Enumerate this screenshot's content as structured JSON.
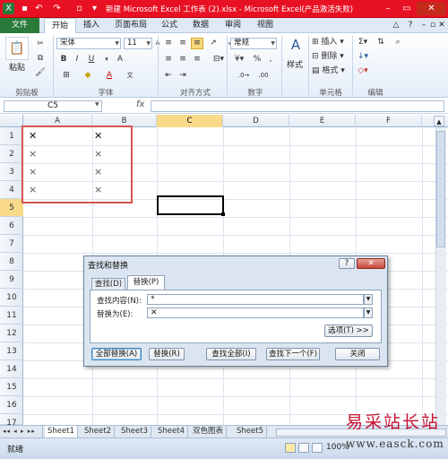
{
  "window": {
    "title": "新建 Microsoft Excel 工作表 (2).xlsx - Microsoft Excel(产品激活失败)",
    "accent_color": "#e81123"
  },
  "ribbon": {
    "tabs": [
      "文件",
      "开始",
      "插入",
      "页面布局",
      "公式",
      "数据",
      "审阅",
      "视图"
    ],
    "font_name": "宋体",
    "font_size": "11",
    "number_format": "常规",
    "paste_label": "粘贴",
    "styles_label": "样式",
    "insert_label": "插入",
    "delete_label": "删除",
    "format_label": "格式",
    "group_labels": [
      "剪贴板",
      "字体",
      "对齐方式",
      "数字",
      "单元格",
      "编辑"
    ]
  },
  "formula_bar": {
    "name_box": "C5",
    "fx": "fx",
    "value": ""
  },
  "grid": {
    "columns": [
      "A",
      "B",
      "C",
      "D",
      "E",
      "F"
    ],
    "rows": [
      "1",
      "2",
      "3",
      "4",
      "5",
      "6",
      "7",
      "8",
      "9",
      "10",
      "11",
      "12",
      "13",
      "14",
      "15",
      "16",
      "17"
    ],
    "cells": [
      {
        "ref": "A1",
        "value": "✕"
      },
      {
        "ref": "B1",
        "value": "✕"
      },
      {
        "ref": "A2",
        "value": "×"
      },
      {
        "ref": "B2",
        "value": "×"
      },
      {
        "ref": "A3",
        "value": "×"
      },
      {
        "ref": "B3",
        "value": "×"
      },
      {
        "ref": "A4",
        "value": "×"
      },
      {
        "ref": "B4",
        "value": "×"
      }
    ],
    "active_cell": "C5",
    "highlight_color": "#d9534f"
  },
  "sheets": [
    "Sheet1",
    "Sheet2",
    "Sheet3",
    "Sheet4",
    "双色图表",
    "Sheet5"
  ],
  "status": {
    "ready": "就绪",
    "zoom": "100%"
  },
  "dialog": {
    "title": "查找和替换",
    "help": "?",
    "close_x": "✕",
    "tabs": [
      "查找(D)",
      "替换(P)"
    ],
    "find_label": "查找内容(N):",
    "find_value": "*",
    "replace_label": "替换为(E):",
    "replace_value": "✕",
    "options_button": "选项(T) >>",
    "buttons": [
      "全部替换(A)",
      "替换(R)",
      "查找全部(I)",
      "查找下一个(F)",
      "关闭"
    ]
  },
  "watermark": {
    "line1": "易采站长站",
    "line2": "www.easck.com"
  }
}
